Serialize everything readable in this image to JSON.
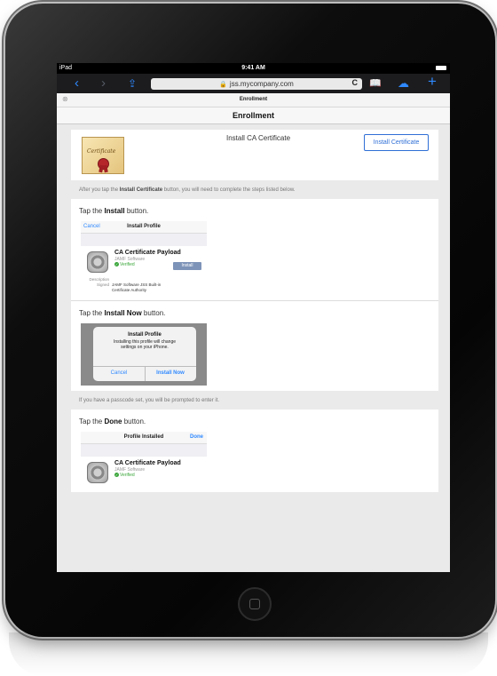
{
  "statusbar": {
    "carrier": "iPad",
    "time": "9:41 AM"
  },
  "browser": {
    "url": "jss.mycompany.com",
    "tab_title": "Enrollment",
    "close_symbol": "⊗",
    "buttons": {
      "back": "‹",
      "forward": "›",
      "share": "⇪",
      "reload": "C",
      "bookmarks": "📖",
      "cloud": "☁",
      "new_tab": "+"
    }
  },
  "page": {
    "title": "Enrollment",
    "cert_card": {
      "title": "Install CA Certificate",
      "button": "Install Certificate",
      "image_text": "Certificate"
    },
    "note1_prefix": "After you tap the ",
    "note1_bold": "Install Certificate",
    "note1_suffix": " button, you will need to complete the steps listed below.",
    "step1": {
      "prefix": "Tap the ",
      "bold": "Install",
      "suffix": " button."
    },
    "step1_shot": {
      "cancel": "Cancel",
      "title": "Install Profile",
      "profile_name": "CA Certificate Payload",
      "profile_org": "JAMF Software",
      "verified": "Verified",
      "install": "Install",
      "desc_label": "Description",
      "signed_label": "Signed",
      "signed_value_1": "JAMF Software JSS Built-in",
      "signed_value_2": "Certificate Authority"
    },
    "step2": {
      "prefix": "Tap the ",
      "bold": "Install Now",
      "suffix": " button."
    },
    "step2_shot": {
      "alert_title": "Install Profile",
      "alert_msg_1": "Installing this profile will change",
      "alert_msg_2": "settings on your iPhone.",
      "cancel": "Cancel",
      "install_now": "Install Now"
    },
    "note2": "If you have a passcode set, you will be prompted to enter it.",
    "step3": {
      "prefix": "Tap the ",
      "bold": "Done",
      "suffix": " button."
    },
    "step3_shot": {
      "title": "Profile Installed",
      "done": "Done",
      "profile_name": "CA Certificate Payload",
      "profile_org": "JAMF Software",
      "verified": "Verified"
    }
  },
  "colors": {
    "accent": "#2f89ff",
    "verified": "#3aa63a",
    "device": "#0d0d0d"
  }
}
